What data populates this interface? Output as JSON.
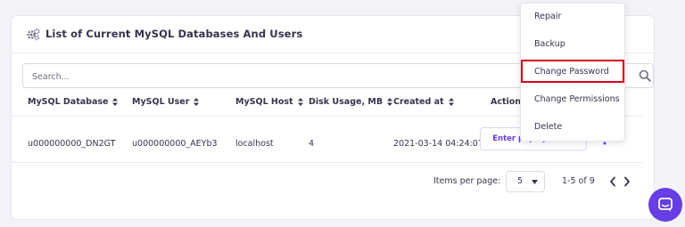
{
  "card": {
    "title": "List of Current MySQL Databases And Users",
    "title_icon": "gears-icon"
  },
  "search": {
    "placeholder": "Search...",
    "value": "",
    "icon": "search-icon"
  },
  "table": {
    "columns": [
      "MySQL Database",
      "MySQL User",
      "MySQL Host",
      "Disk Usage, MB",
      "Created at",
      "Actions"
    ],
    "rows": [
      {
        "database": "u000000000_DN2GT",
        "user": "u000000000_AEYb3",
        "host": "localhost",
        "disk_usage": "4",
        "created_at": "2021-03-14 04:24:07",
        "action_button": "Enter phpMyAdmin"
      }
    ]
  },
  "pagination": {
    "items_per_page_label": "Items per page:",
    "items_per_page_value": "5",
    "range": "1-5 of 9"
  },
  "menu": {
    "items": [
      "Repair",
      "Backup",
      "Change Password",
      "Change Permissions",
      "Delete"
    ],
    "highlighted": "Change Password"
  },
  "colors": {
    "accent": "#673de6",
    "highlight_border": "#d6001c",
    "text": "#36344d",
    "background": "#f3f3f7"
  }
}
